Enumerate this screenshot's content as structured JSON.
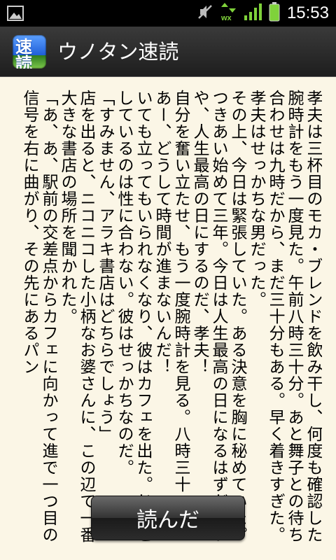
{
  "status_bar": {
    "time": "15:53",
    "network_label": "wx",
    "icons": [
      "image-notification-icon",
      "mute-icon",
      "data-arrows-icon",
      "signal-icon",
      "battery-icon"
    ]
  },
  "app": {
    "title": "ウノタン速読",
    "icon_text": "速読"
  },
  "reader": {
    "text": "孝夫は三杯目のモカ・ブレンドを飲み干し、何度も確認した腕時計をもう一度見た。午前八時三十分。あと舞子との待ち合わせは九時だから、まだ三十分もある。早く着きすぎた。孝夫はせっかちな男だった。\nその上、今日は緊張していた。ある決意を胸に秘めていた。つきあい始めて三年。今日は人生最高の日になるはずだ。いや、人生最高の日にするのだ、孝夫！\n自分を奮い立たせ、もう一度腕時計を見る。八時三十一分。あー、どうして時間が進まないんだ！\nいても立ってもいられなくなり、彼はカフェを出た。じっとしているのは性に合わない。彼はせっかちなのだ。\n「すみません、アラキ書店はどちらでしょう」\n店を出ると、ニコニコした小柄なお婆さんに、この辺で一番大きな書店の場所を聞かれた。\n「あ、あ、駅前の交差点からカフェに向かって進で一つ目の信号を右に曲がり、その先にあるパン"
  },
  "button": {
    "label": "読んだ"
  },
  "colors": {
    "page_background": "#fbf6e6",
    "titlebar": "#2a2a2a",
    "battery": "#7fd23a"
  }
}
